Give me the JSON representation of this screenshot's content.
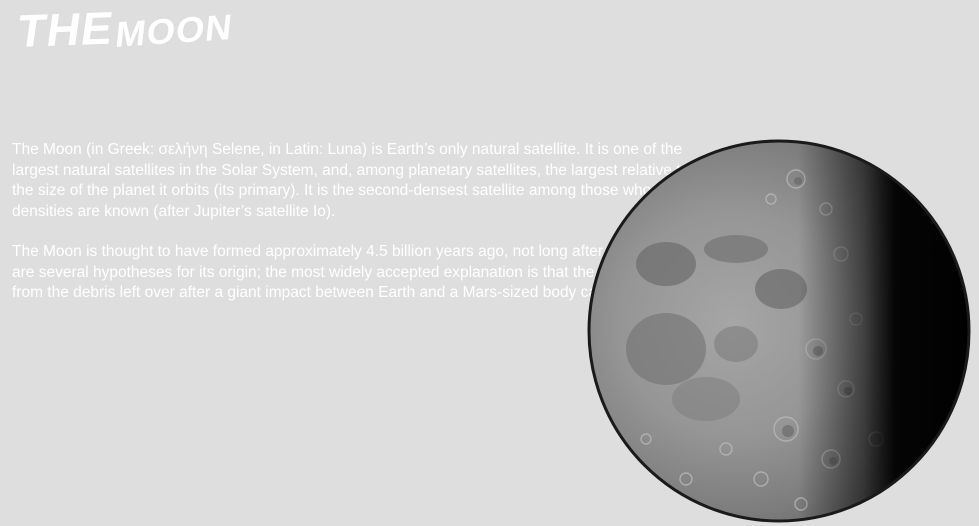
{
  "page": {
    "title_part1": "THE",
    "title_part2": "MOON"
  },
  "content": {
    "paragraphs": [
      "The Moon (in Greek: σελήνη Selene, in Latin: Luna) is Earth’s only natural satellite. It is one of the largest natural satellites in the Solar System, and, among planetary satellites, the largest relative to the size of the planet it orbits (its primary). It is the second-densest satellite among those whose densities are known (after Jupiter’s satellite Io).",
      "The Moon is thought to have formed approximately 4.5 billion years ago, not long after Earth. There are several hypotheses for its origin; the most widely accepted explanation is that the Moon formed from the debris left over after a giant impact between Earth and a Mars-sized body called Theia."
    ]
  },
  "colors": {
    "background": "#dedede",
    "text": "#ffffff",
    "moon_surface": "#8f8f8f",
    "moon_shadow": "#050505"
  },
  "image": {
    "icon": "moon-photo"
  }
}
